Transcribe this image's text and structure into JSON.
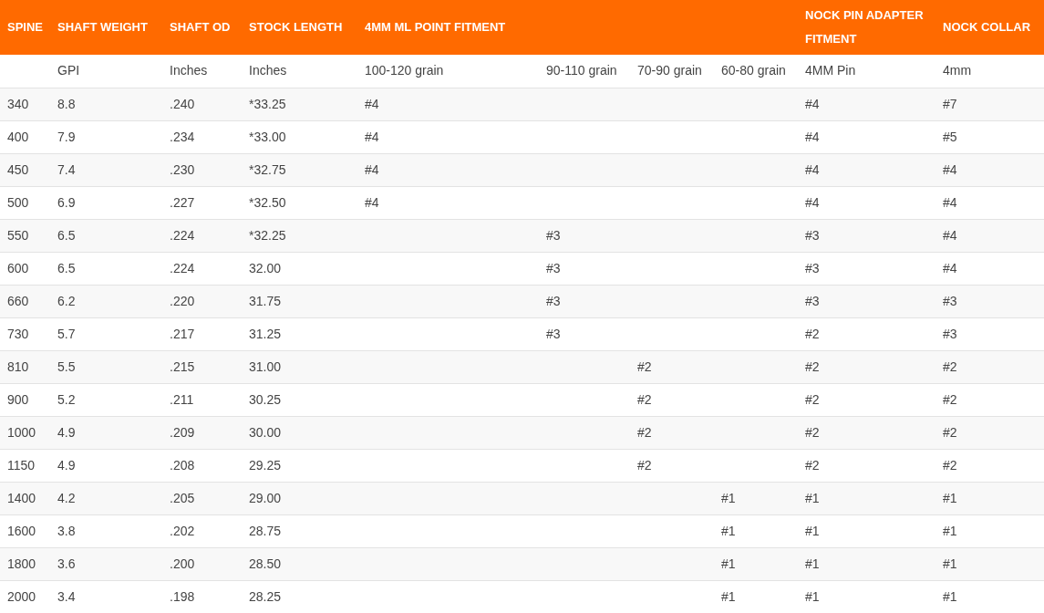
{
  "table": {
    "headers": [
      {
        "kind": "single",
        "label": "SPINE"
      },
      {
        "kind": "single",
        "label": "SHAFT WEIGHT"
      },
      {
        "kind": "single",
        "label": "SHAFT OD"
      },
      {
        "kind": "single",
        "label": "STOCK LENGTH"
      },
      {
        "kind": "group",
        "label": "4MM ML POINT FITMENT"
      },
      {
        "kind": "single",
        "label": "NOCK PIN ADAPTER FITMENT"
      },
      {
        "kind": "single",
        "label": "NOCK COLLAR"
      }
    ],
    "units": {
      "shaft_weight": "GPI",
      "shaft_od": "Inches",
      "stock_length": "Inches",
      "point_100_120": "100-120 grain",
      "point_90_110": "90-110 grain",
      "point_70_90": "70-90 grain",
      "point_60_80": "60-80 grain",
      "nock_pin": "4MM Pin",
      "nock_collar": "4mm"
    },
    "rows": [
      {
        "spine": "340",
        "shaft_weight": "8.8",
        "shaft_od": ".240",
        "stock_length": "*33.25",
        "point_100_120": "#4",
        "nock_pin": "#4",
        "nock_collar": "#7"
      },
      {
        "spine": "400",
        "shaft_weight": "7.9",
        "shaft_od": ".234",
        "stock_length": "*33.00",
        "point_100_120": "#4",
        "nock_pin": "#4",
        "nock_collar": "#5"
      },
      {
        "spine": "450",
        "shaft_weight": "7.4",
        "shaft_od": ".230",
        "stock_length": "*32.75",
        "point_100_120": "#4",
        "nock_pin": "#4",
        "nock_collar": "#4"
      },
      {
        "spine": "500",
        "shaft_weight": "6.9",
        "shaft_od": ".227",
        "stock_length": "*32.50",
        "point_100_120": "#4",
        "nock_pin": "#4",
        "nock_collar": "#4"
      },
      {
        "spine": "550",
        "shaft_weight": "6.5",
        "shaft_od": ".224",
        "stock_length": "*32.25",
        "point_90_110": "#3",
        "nock_pin": "#3",
        "nock_collar": "#4"
      },
      {
        "spine": "600",
        "shaft_weight": "6.5",
        "shaft_od": ".224",
        "stock_length": "32.00",
        "point_90_110": "#3",
        "nock_pin": "#3",
        "nock_collar": "#4"
      },
      {
        "spine": "660",
        "shaft_weight": "6.2",
        "shaft_od": ".220",
        "stock_length": "31.75",
        "point_90_110": "#3",
        "nock_pin": "#3",
        "nock_collar": "#3"
      },
      {
        "spine": "730",
        "shaft_weight": "5.7",
        "shaft_od": ".217",
        "stock_length": "31.25",
        "point_90_110": "#3",
        "nock_pin": "#2",
        "nock_collar": "#3"
      },
      {
        "spine": "810",
        "shaft_weight": "5.5",
        "shaft_od": ".215",
        "stock_length": "31.00",
        "point_70_90": "#2",
        "nock_pin": "#2",
        "nock_collar": "#2"
      },
      {
        "spine": "900",
        "shaft_weight": "5.2",
        "shaft_od": ".211",
        "stock_length": "30.25",
        "point_70_90": "#2",
        "nock_pin": "#2",
        "nock_collar": "#2"
      },
      {
        "spine": "1000",
        "shaft_weight": "4.9",
        "shaft_od": ".209",
        "stock_length": "30.00",
        "point_70_90": "#2",
        "nock_pin": "#2",
        "nock_collar": "#2"
      },
      {
        "spine": "1150",
        "shaft_weight": "4.9",
        "shaft_od": ".208",
        "stock_length": "29.25",
        "point_70_90": "#2",
        "nock_pin": "#2",
        "nock_collar": "#2"
      },
      {
        "spine": "1400",
        "shaft_weight": "4.2",
        "shaft_od": ".205",
        "stock_length": "29.00",
        "point_60_80": "#1",
        "nock_pin": "#1",
        "nock_collar": "#1"
      },
      {
        "spine": "1600",
        "shaft_weight": "3.8",
        "shaft_od": ".202",
        "stock_length": "28.75",
        "point_60_80": "#1",
        "nock_pin": "#1",
        "nock_collar": "#1"
      },
      {
        "spine": "1800",
        "shaft_weight": "3.6",
        "shaft_od": ".200",
        "stock_length": "28.50",
        "point_60_80": "#1",
        "nock_pin": "#1",
        "nock_collar": "#1"
      },
      {
        "spine": "2000",
        "shaft_weight": "3.4",
        "shaft_od": ".198",
        "stock_length": "28.25",
        "point_60_80": "#1",
        "nock_pin": "#1",
        "nock_collar": "#1"
      }
    ]
  }
}
